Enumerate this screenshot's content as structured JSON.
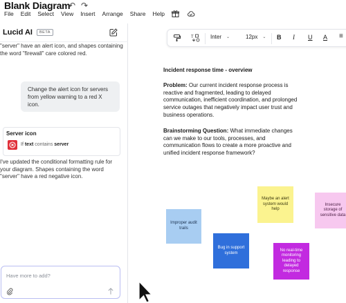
{
  "app": {
    "title": "Blank Diagram",
    "undo_icon": "undo-icon",
    "redo_icon": "redo-icon"
  },
  "menu": {
    "items": [
      "File",
      "Edit",
      "Select",
      "View",
      "Insert",
      "Arrange",
      "Share",
      "Help"
    ],
    "icons": [
      "gift-icon",
      "cloud-check-icon"
    ]
  },
  "ai_panel": {
    "title": "Lucid AI",
    "badge": "BETA",
    "new_chat_icon": "edit-icon",
    "message1": "\"server\" have an alert icon, and shapes containing the word \"firewall\" care colored red.",
    "user_message": "Change the alert icon for servers from yellow warning to a red X icon.",
    "rule": {
      "title": "Server icon",
      "icon": "red-x-icon",
      "cond_prefix": "If",
      "cond_field": "text",
      "cond_op": "contains",
      "cond_value": "server"
    },
    "message2": "I've updated the conditional formatting rule for your diagram. Shapes containing the word \"server\" have a red negative icon.",
    "input_placeholder": "Have more to add?",
    "attach_icon": "paperclip-icon",
    "send_icon": "send-arrow-icon"
  },
  "toolbar": {
    "font": "Inter",
    "font_size": "12px",
    "bold": "B",
    "italic": "I",
    "underline": "U",
    "text_align": "A",
    "list": "≡"
  },
  "canvas": {
    "heading": "Incident response time - overview",
    "problem_label": "Problem:",
    "problem_text": " Our current incident response process is reactive and fragmented, leading to delayed communication, inefficient coordination, and prolonged service outages that negatively impact user trust and business operations.",
    "question_label": "Brainstorming Question:",
    "question_text": " What immediate changes can we make to our tools, processes, and communication flows to create a more proactive and unified incident response framework?",
    "stickies": [
      "Improper audit trails",
      "Bug in support system",
      "Maybe an alert system would help",
      "No real-time monitoring leading to delayed response",
      "Insecure storage of sensitive data"
    ]
  },
  "colors": {
    "sticky_light_blue": "#a8cdf2",
    "sticky_blue": "#2f6fdb",
    "sticky_yellow": "#fbf38f",
    "sticky_purple": "#c22ae0",
    "sticky_pink": "#f7c8ef",
    "rule_icon_red": "#e0303a",
    "chat_border": "#b9bdf2"
  }
}
